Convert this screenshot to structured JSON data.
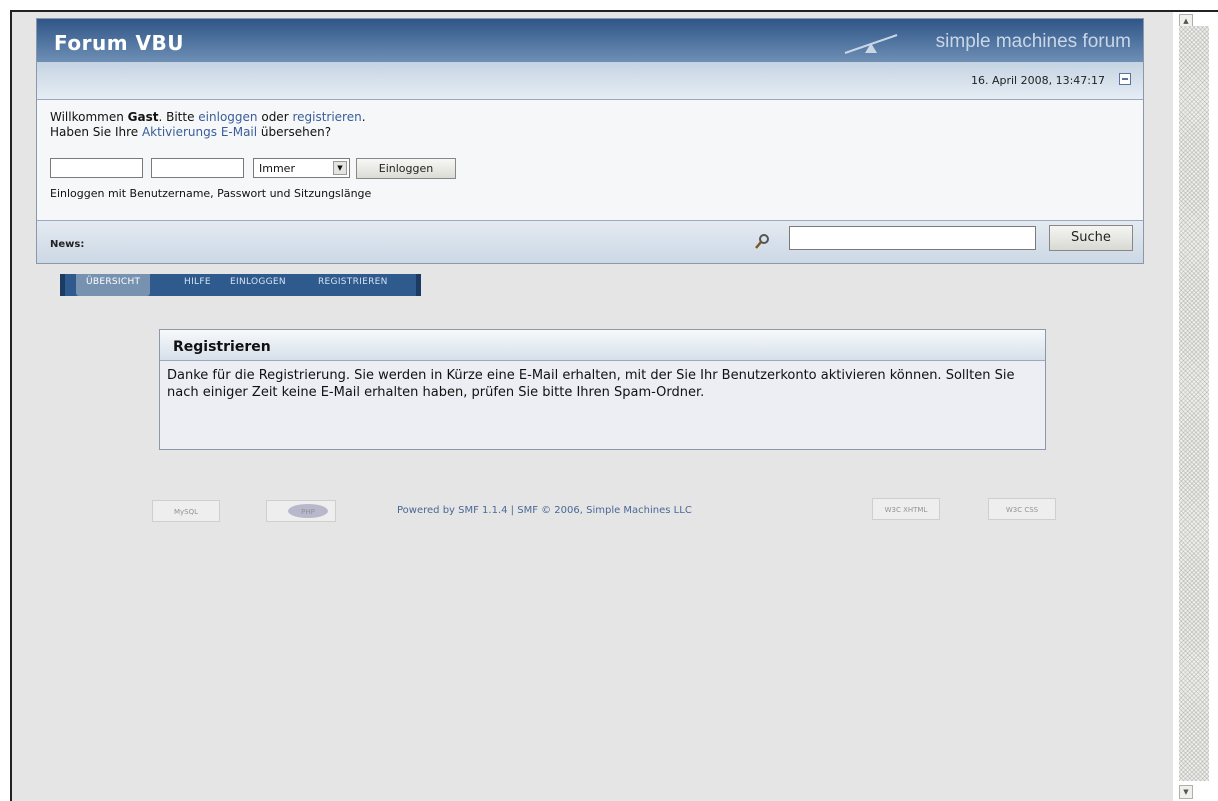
{
  "header": {
    "forum_title": "Forum VBU",
    "logo_text": "simple machines forum",
    "date_time": "16. April 2008, 13:47:17"
  },
  "user": {
    "welcome_prefix": "Willkommen ",
    "guest": "Gast",
    "please": ". Bitte ",
    "login_link": "einloggen",
    "or": " oder ",
    "register_link": "registrieren",
    "period": ".",
    "activation_prefix": "Haben Sie Ihre ",
    "activation_link": "Aktivierungs E-Mail",
    "activation_suffix": " übersehen?",
    "session_value": "Immer",
    "login_button": "Einloggen",
    "login_hint": "Einloggen mit Benutzername, Passwort und Sitzungslänge"
  },
  "news": {
    "label": "News:",
    "search_button": "Suche"
  },
  "menu": {
    "items": [
      "ÜBERSICHT",
      "HILFE",
      "EINLOGGEN",
      "REGISTRIEREN"
    ]
  },
  "register": {
    "title": "Registrieren",
    "message": "Danke für die Registrierung. Sie werden in Kürze eine E-Mail erhalten, mit der Sie Ihr Benutzerkonto aktivieren können. Sollten Sie nach einiger Zeit keine E-Mail erhalten haben, prüfen Sie bitte Ihren Spam-Ordner."
  },
  "footer": {
    "powered": "Powered by SMF 1.1.4 | SMF © 2006, Simple Machines LLC",
    "badges": [
      "MySQL",
      "PHP",
      "W3C XHTML",
      "W3C CSS"
    ]
  },
  "colors": {
    "title_bar": "#2f5588",
    "link": "#3a5d9a",
    "menu": "#2e5a8e",
    "page_bg": "#e5e5e5"
  }
}
